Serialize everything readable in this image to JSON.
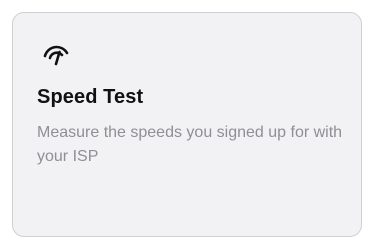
{
  "card": {
    "icon": "speedometer-icon",
    "title": "Speed Test",
    "description": "Measure the speeds you signed up for with your ISP"
  },
  "colors": {
    "card_background": "#f2f2f4",
    "card_border": "#cfcfd4",
    "title": "#111111",
    "description": "#8f8f94"
  }
}
